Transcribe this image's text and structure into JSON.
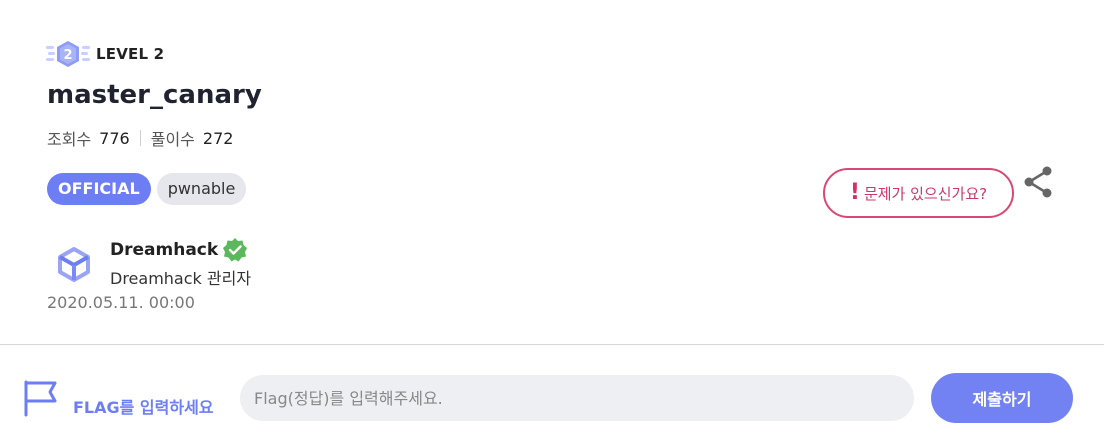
{
  "challenge": {
    "level": "LEVEL 2",
    "level_number": "2",
    "title": "master_canary",
    "views_label": "조회수",
    "views": "776",
    "solves_label": "풀이수",
    "solves": "272",
    "tags": [
      "OFFICIAL",
      "pwnable"
    ]
  },
  "author": {
    "name": "Dreamhack",
    "role": "Dreamhack 관리자",
    "date": "2020.05.11. 00:00"
  },
  "actions": {
    "report_label": "문제가 있으신가요?",
    "report_mark": "!"
  },
  "flag": {
    "label": "FLAG를 입력하세요",
    "placeholder": "Flag(정답)를 입력해주세요.",
    "value": "",
    "submit_label": "제출하기"
  },
  "colors": {
    "accent": "#6d7ef5",
    "report": "#d94875",
    "verified": "#4caf50"
  },
  "icons": [
    "level-badge-icon",
    "dreamhack-logo-icon",
    "verified-icon",
    "share-icon",
    "flag-icon"
  ]
}
